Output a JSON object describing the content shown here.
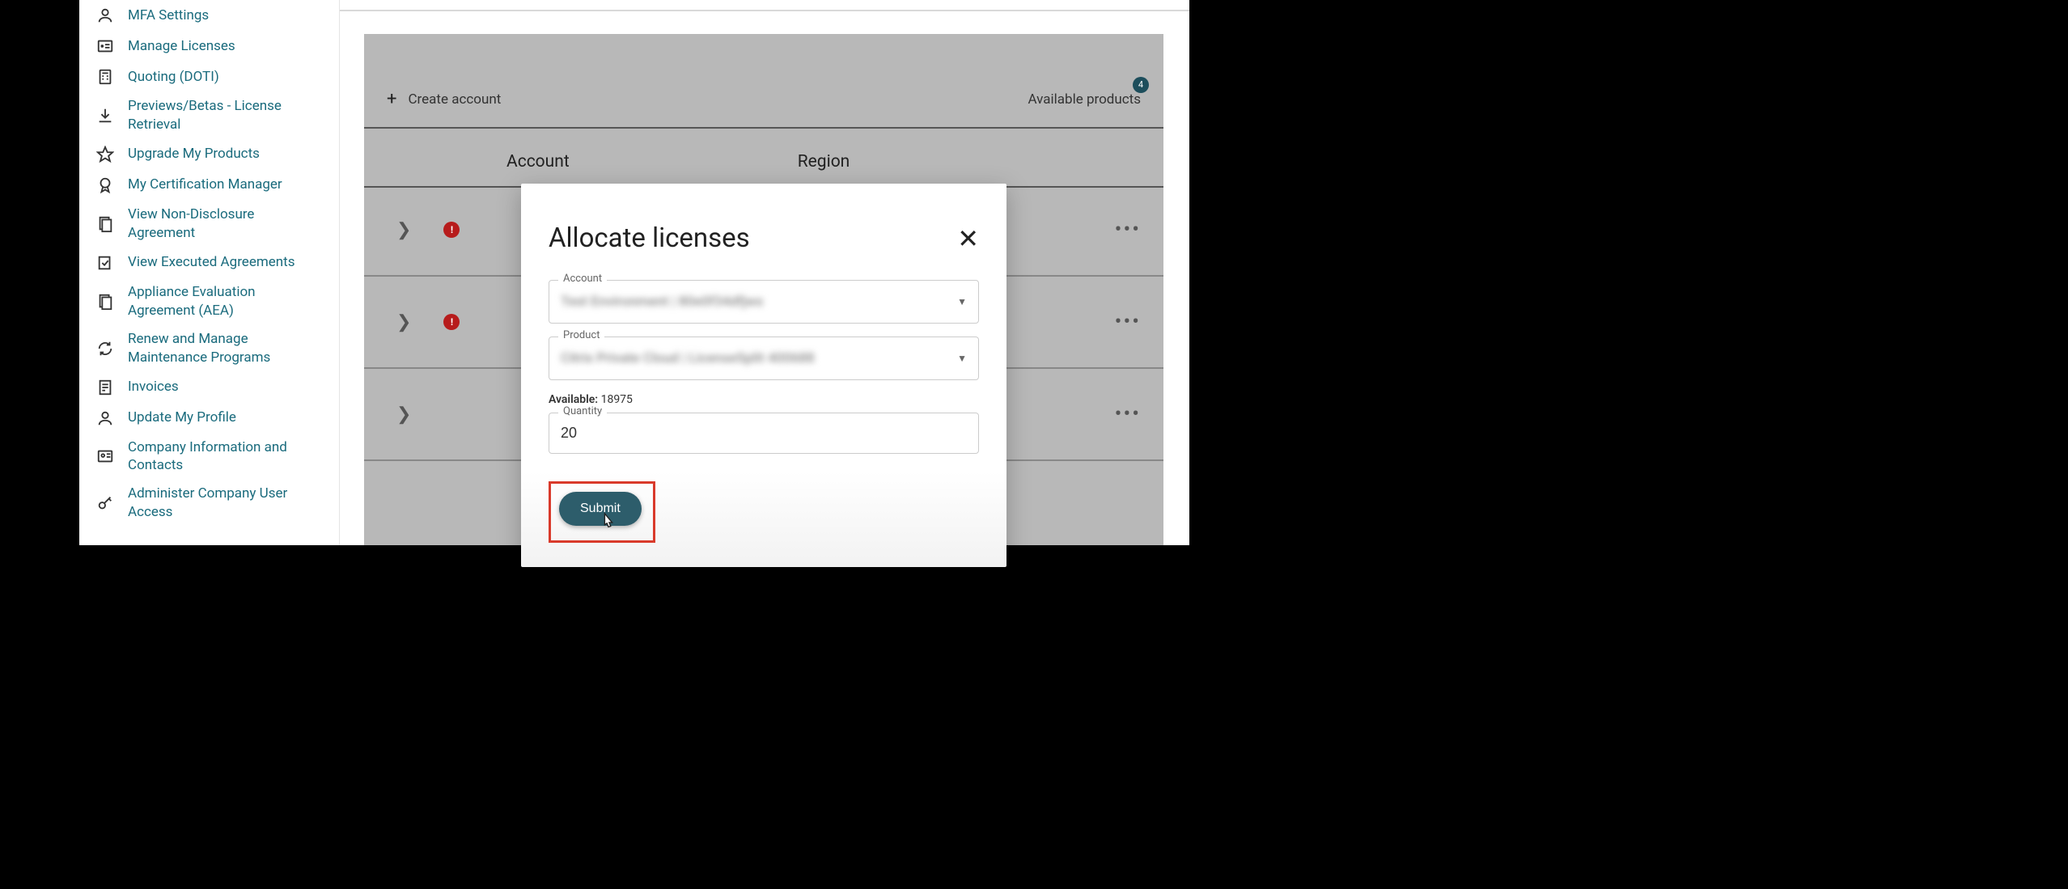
{
  "sidebar": {
    "items": [
      {
        "label": "MFA Settings"
      },
      {
        "label": "Manage Licenses"
      },
      {
        "label": "Quoting (DOTI)"
      },
      {
        "label": "Previews/Betas - License Retrieval"
      },
      {
        "label": "Upgrade My Products"
      },
      {
        "label": "My Certification Manager"
      },
      {
        "label": "View Non-Disclosure Agreement"
      },
      {
        "label": "View Executed Agreements"
      },
      {
        "label": "Appliance Evaluation Agreement (AEA)"
      },
      {
        "label": "Renew and Manage Maintenance Programs"
      },
      {
        "label": "Invoices"
      },
      {
        "label": "Update My Profile"
      },
      {
        "label": "Company Information and Contacts"
      },
      {
        "label": "Administer Company User Access"
      }
    ]
  },
  "toolbar": {
    "create_label": "Create account",
    "available_label": "Available products",
    "badge": "4"
  },
  "table": {
    "headers": {
      "account": "Account",
      "region": "Region"
    }
  },
  "modal": {
    "title": "Allocate licenses",
    "account_label": "Account",
    "account_value": "Test Environment | 80e0f34dfjws",
    "product_label": "Product",
    "product_value": "Citrix Private Cloud | LicenseSplit 400688",
    "available_label": "Available:",
    "available_value": "18975",
    "quantity_label": "Quantity",
    "quantity_value": "20",
    "submit_label": "Submit"
  }
}
